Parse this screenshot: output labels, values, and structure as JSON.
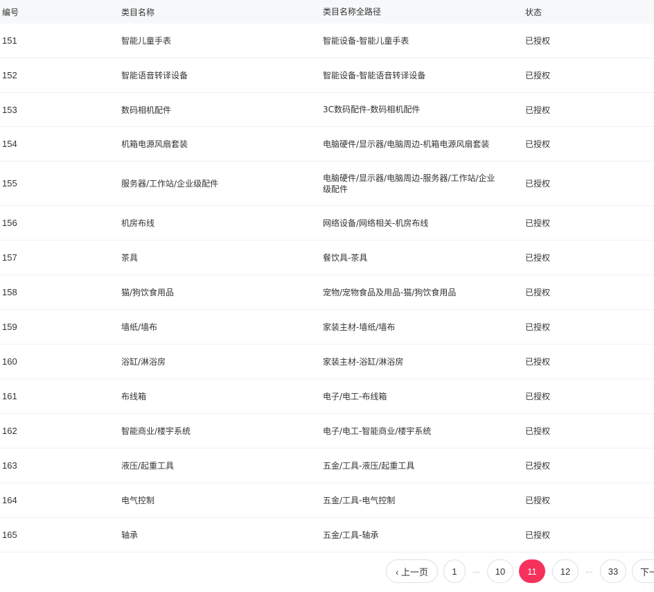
{
  "header": {
    "id": "编号",
    "name": "类目名称",
    "path": "类目名称全路径",
    "status": "状态"
  },
  "rows": [
    {
      "id": "151",
      "name": "智能儿童手表",
      "path": "智能设备-智能儿童手表",
      "status": "已授权"
    },
    {
      "id": "152",
      "name": "智能语音转译设备",
      "path": "智能设备-智能语音转译设备",
      "status": "已授权"
    },
    {
      "id": "153",
      "name": "数码相机配件",
      "path": "3C数码配件-数码相机配件",
      "status": "已授权"
    },
    {
      "id": "154",
      "name": "机箱电源风扇套装",
      "path": "电脑硬件/显示器/电脑周边-机箱电源风扇套装",
      "status": "已授权"
    },
    {
      "id": "155",
      "name": "服务器/工作站/企业级配件",
      "path": "电脑硬件/显示器/电脑周边-服务器/工作站/企业级配件",
      "status": "已授权"
    },
    {
      "id": "156",
      "name": "机房布线",
      "path": "网络设备/网络相关-机房布线",
      "status": "已授权"
    },
    {
      "id": "157",
      "name": "茶具",
      "path": "餐饮具-茶具",
      "status": "已授权"
    },
    {
      "id": "158",
      "name": "猫/狗饮食用品",
      "path": "宠物/宠物食品及用品-猫/狗饮食用品",
      "status": "已授权"
    },
    {
      "id": "159",
      "name": "墙纸/墙布",
      "path": "家装主材-墙纸/墙布",
      "status": "已授权"
    },
    {
      "id": "160",
      "name": "浴缸/淋浴房",
      "path": "家装主材-浴缸/淋浴房",
      "status": "已授权"
    },
    {
      "id": "161",
      "name": "布线箱",
      "path": "电子/电工-布线箱",
      "status": "已授权"
    },
    {
      "id": "162",
      "name": "智能商业/楼宇系统",
      "path": "电子/电工-智能商业/楼宇系统",
      "status": "已授权"
    },
    {
      "id": "163",
      "name": "液压/起重工具",
      "path": "五金/工具-液压/起重工具",
      "status": "已授权"
    },
    {
      "id": "164",
      "name": "电气控制",
      "path": "五金/工具-电气控制",
      "status": "已授权"
    },
    {
      "id": "165",
      "name": "轴承",
      "path": "五金/工具-轴承",
      "status": "已授权"
    }
  ],
  "pagination": {
    "prev": "‹ 上一页",
    "pages": [
      "1",
      "10",
      "11",
      "12",
      "33"
    ],
    "ellipsis": "…",
    "current": "11",
    "next": "下一"
  }
}
